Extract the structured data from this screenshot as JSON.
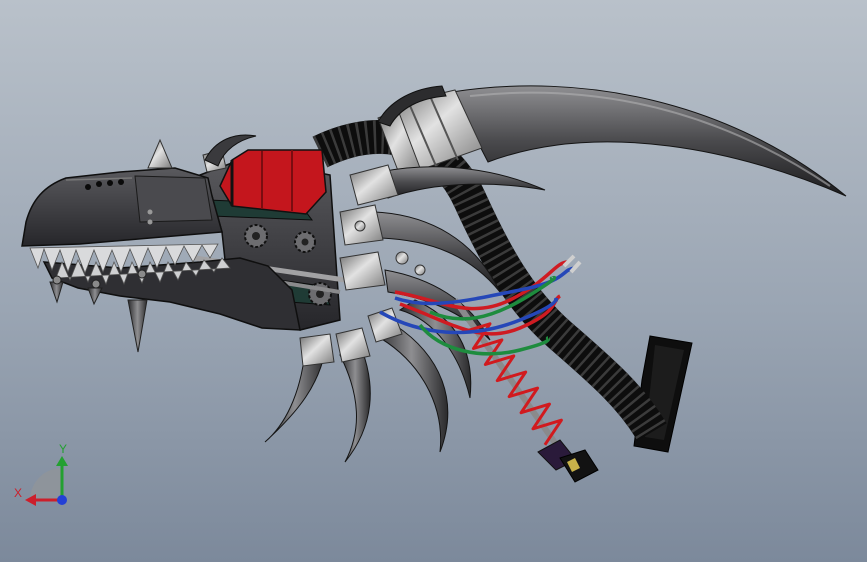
{
  "viewport": {
    "background_top": "#b9c1ca",
    "background_mid": "#9aa5b3",
    "background_bottom": "#7c899b"
  },
  "model": {
    "palette": {
      "body": "#2f2f33",
      "metal": "#b5b5b5",
      "accent_red": "#c4161d",
      "panel_teal": "#1f3b35",
      "hose": "#0d0d0d",
      "block": "#0e0e0e",
      "spring": "#d11a1e",
      "wire_red": "#cf1b22",
      "wire_blue": "#2547b8",
      "wire_green": "#1e8c3e",
      "end_cap": "#2a1a3a"
    }
  },
  "triad": {
    "icon": "reference-triad-icon",
    "y_label": "Y",
    "x_label": "X",
    "y_color": "#23a031",
    "x_color": "#cc1f2b",
    "z_color": "#2340d6",
    "sphere_color": "#8f949a"
  }
}
